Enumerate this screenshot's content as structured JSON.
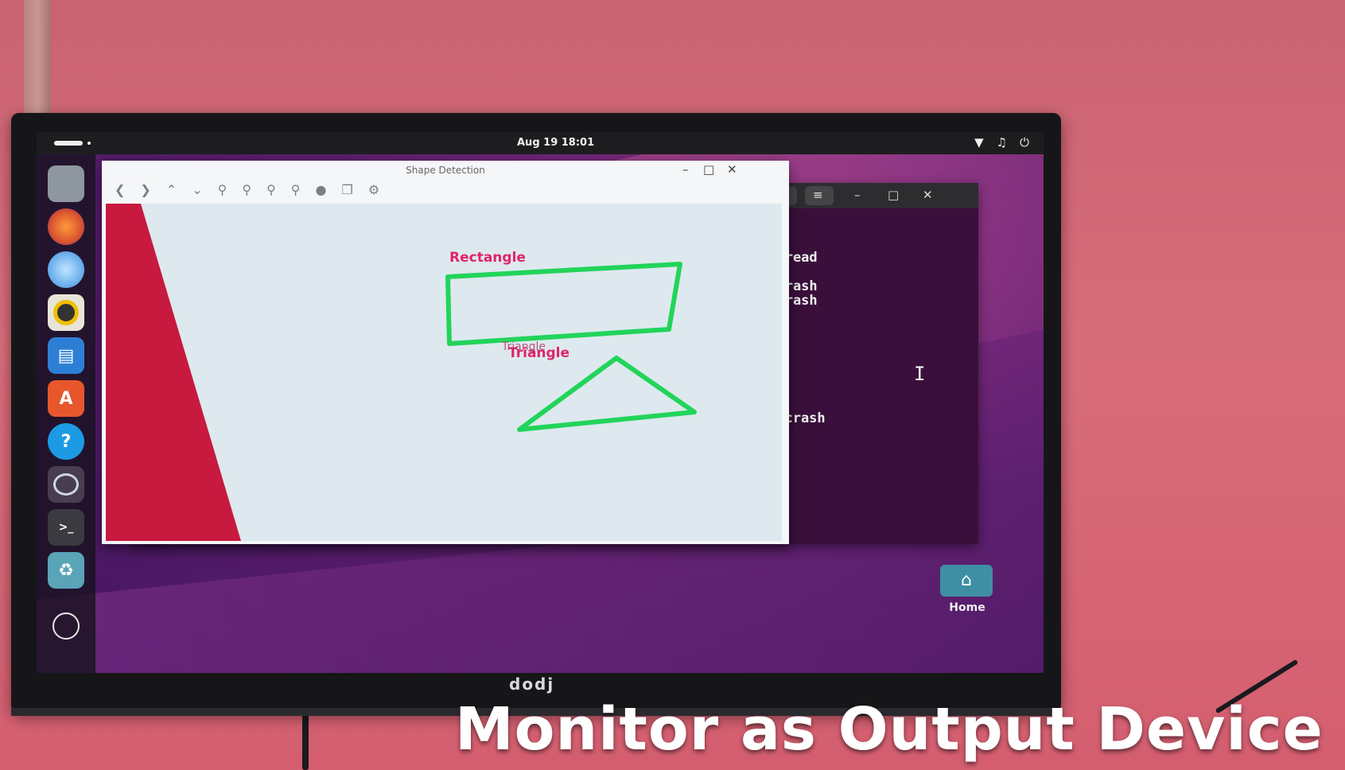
{
  "scene": {
    "monitor_brand": "dodj",
    "caption": "Monitor as Output Device"
  },
  "topbar": {
    "clock": "Aug 19 18:01",
    "tray_icons": [
      "wifi-icon",
      "volume-icon",
      "power-icon"
    ]
  },
  "dock": {
    "items": [
      "files-icon",
      "firefox-icon",
      "thunderbird-icon",
      "rhythmbox-icon",
      "libreoffice-writer-icon",
      "app-center-icon",
      "help-icon",
      "snapshot-icon",
      "terminal-icon",
      "trash-icon",
      "show-apps-icon"
    ]
  },
  "shape_window": {
    "title": "Shape Detection",
    "toolbar_icons": [
      "back-icon",
      "forward-icon",
      "up-icon",
      "down-icon",
      "zoom-in-icon",
      "zoom-out-icon",
      "zoom-fit-icon",
      "zoom-reset-icon",
      "pin-icon",
      "copy-icon",
      "settings-icon"
    ],
    "detections": [
      {
        "label": "Rectangle",
        "color": "#e0246a",
        "outline_color": "#22d45a"
      },
      {
        "label": "Triangle",
        "color": "#e0246a",
        "outline_color": "#22d45a"
      },
      {
        "label": "Triangle",
        "color": "#b03060",
        "outline_color": "#22d45a"
      }
    ]
  },
  "terminal": {
    "lines": [
      "QThread",
      "o crash",
      "o crash",
      "o crash"
    ]
  },
  "desktop": {
    "home_label": "Home"
  },
  "colors": {
    "wall": "#d06272",
    "desktop_bg": "#5d1f6f",
    "terminal_bg": "#3a0f3b",
    "detection_outline": "#22d45a",
    "detection_label": "#e0246a"
  }
}
